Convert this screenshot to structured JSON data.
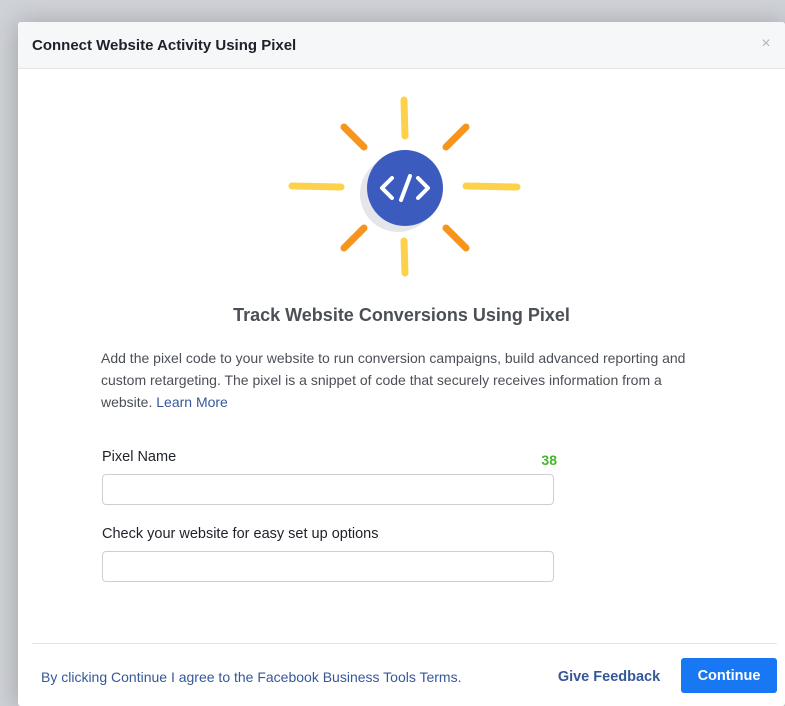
{
  "dialog": {
    "title": "Connect Website Activity Using Pixel",
    "close_glyph": "×"
  },
  "hero": {
    "icon": "code-icon",
    "colors": {
      "circle": "#3b5bbf",
      "ray_orange": "#f7941d",
      "ray_yellow": "#fdd24a",
      "shadow": "#e4e6eb"
    }
  },
  "heading": "Track Website Conversions Using Pixel",
  "description": {
    "text": "Add the pixel code to your website to run conversion campaigns, build advanced reporting and custom retargeting. The pixel is a snippet of code that securely receives information from a website.",
    "link": "Learn More"
  },
  "pixel_name": {
    "label": "Pixel Name",
    "counter": "38",
    "value": "",
    "placeholder": ""
  },
  "website": {
    "label": "Check your website for easy set up options",
    "value": "",
    "placeholder": ""
  },
  "footer": {
    "terms": "By clicking Continue I agree to the Facebook Business Tools Terms.",
    "feedback": "Give Feedback",
    "continue": "Continue"
  },
  "colors": {
    "primary": "#1877f2",
    "link": "#365899",
    "counter": "#42b72a"
  }
}
